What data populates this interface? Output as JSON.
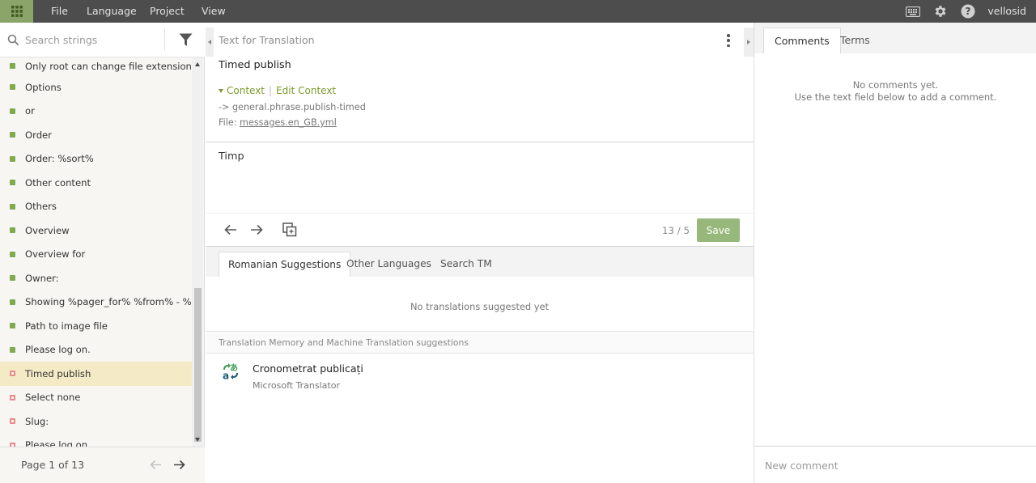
{
  "topbar": {
    "menu": [
      "File",
      "Language",
      "Project",
      "View"
    ],
    "user": "vellosid",
    "icons": [
      "apps-grid-icon",
      "keyboard-icon",
      "gear-icon",
      "help-icon"
    ]
  },
  "left": {
    "search_placeholder": "Search strings",
    "items": [
      {
        "label": "Only root can change file extensions.",
        "status": "translated"
      },
      {
        "label": "Options",
        "status": "translated"
      },
      {
        "label": "or",
        "status": "translated"
      },
      {
        "label": "Order",
        "status": "translated"
      },
      {
        "label": "Order: %sort%",
        "status": "translated"
      },
      {
        "label": "Other content",
        "status": "translated"
      },
      {
        "label": "Others",
        "status": "translated"
      },
      {
        "label": "Overview",
        "status": "translated"
      },
      {
        "label": "Overview for",
        "status": "translated"
      },
      {
        "label": "Owner:",
        "status": "translated"
      },
      {
        "label": "Showing %pager_for% %from% - %t…",
        "status": "translated"
      },
      {
        "label": "Path to image file",
        "status": "translated"
      },
      {
        "label": "Please log on.",
        "status": "translated"
      },
      {
        "label": "Timed publish",
        "status": "untranslated",
        "active": true
      },
      {
        "label": "Select none",
        "status": "untranslated"
      },
      {
        "label": "Slug:",
        "status": "untranslated"
      },
      {
        "label": "Please log on.",
        "status": "untranslated"
      }
    ],
    "pager_label": "Page 1 of 13"
  },
  "middle": {
    "section_title": "Text for Translation",
    "source_text": "Timed publish",
    "context_label": "Context",
    "edit_context_label": "Edit Context",
    "key": "-> general.phrase.publish-timed",
    "file_prefix": "File: ",
    "file_name": "messages.en_GB.yml",
    "translation_value": "Timp",
    "counter": "13 / 5",
    "save_label": "Save",
    "suggestion_tabs": [
      "Romanian Suggestions",
      "Other Languages",
      "Search TM"
    ],
    "no_suggestions": "No translations suggested yet",
    "tm_header": "Translation Memory and Machine Translation suggestions",
    "tm_items": [
      {
        "text": "Cronometrat publicați",
        "source": "Microsoft Translator"
      }
    ]
  },
  "right": {
    "tabs": [
      "Comments",
      "Terms"
    ],
    "no_comments_line1": "No comments yet.",
    "no_comments_line2": "Use the text field below to add a comment.",
    "comment_placeholder": "New comment"
  },
  "colors": {
    "topbar": "#4d4d4d",
    "accent": "#8aa46a",
    "save_button": "#97b87a",
    "active_row": "#f4ebc6",
    "translated": "#7eab4f",
    "untranslated": "#ec8a8a",
    "context_link": "#7a9a2a"
  }
}
